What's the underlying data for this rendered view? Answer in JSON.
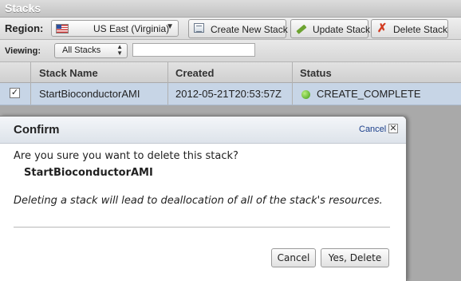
{
  "window": {
    "title": "Stacks"
  },
  "toolbar": {
    "region_label": "Region:",
    "region_value": "US East (Virginia)",
    "create_label": "Create New Stack",
    "update_label": "Update Stack",
    "delete_label": "Delete Stack"
  },
  "filter": {
    "viewing_label": "Viewing:",
    "viewing_value": "All Stacks",
    "search_value": ""
  },
  "table": {
    "columns": [
      "Stack Name",
      "Created",
      "Status"
    ],
    "rows": [
      {
        "selected": true,
        "name": "StartBioconductorAMI",
        "created": "2012-05-21T20:53:57Z",
        "status": "CREATE_COMPLETE",
        "status_color": "#4caf1f"
      }
    ]
  },
  "dialog": {
    "title": "Confirm",
    "close_link": "Cancel",
    "question": "Are you sure you want to delete this stack?",
    "stack_name": "StartBioconductorAMI",
    "note": "Deleting a stack will lead to deallocation of all of the stack's resources.",
    "cancel_label": "Cancel",
    "confirm_label": "Yes, Delete"
  }
}
